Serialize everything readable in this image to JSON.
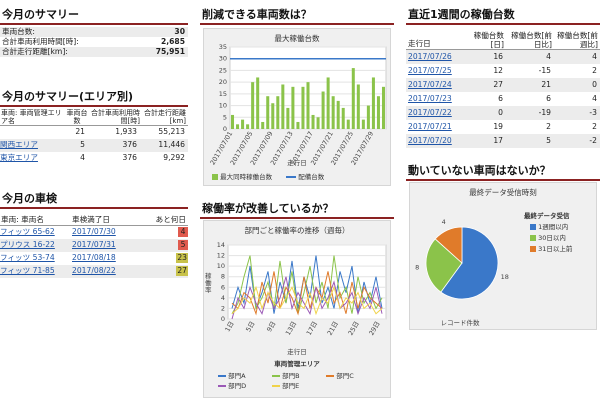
{
  "today_summary": {
    "title": "今月のサマリー",
    "rows": [
      {
        "label": "車両台数:",
        "value": "30"
      },
      {
        "label": "合計車両利用時間[時]:",
        "value": "2,685"
      },
      {
        "label": "合計走行距離[km]:",
        "value": "75,951"
      }
    ]
  },
  "area_summary": {
    "title": "今月のサマリー(エリア別)",
    "headers": [
      "車両: 車両管理エリア名",
      "車両台数",
      "合計車両利用時間[時]",
      "合計走行距離[km]"
    ],
    "rows": [
      {
        "name": "",
        "count": "21",
        "hours": "1,933",
        "km": "55,213"
      },
      {
        "name": "関西エリア",
        "count": "5",
        "hours": "376",
        "km": "11,446"
      },
      {
        "name": "東京エリア",
        "count": "4",
        "hours": "376",
        "km": "9,292"
      }
    ]
  },
  "inspection": {
    "title": "今月の車検",
    "headers": [
      "車両: 車両名",
      "車検満了日",
      "あと何日"
    ],
    "rows": [
      {
        "name": "フィッツ 65-62",
        "date": "2017/07/30",
        "days": "4",
        "color": "#e05a4e"
      },
      {
        "name": "プリウス 16-22",
        "date": "2017/07/31",
        "days": "5",
        "color": "#e05a4e"
      },
      {
        "name": "フィッツ 53-74",
        "date": "2017/08/18",
        "days": "23",
        "color": "#c8c24a"
      },
      {
        "name": "フィッツ 71-85",
        "date": "2017/08/22",
        "days": "27",
        "color": "#c8c24a"
      }
    ]
  },
  "reduce": {
    "title": "削減できる車両数は？",
    "chart_title": "最大稼働台数",
    "xlabel": "走行日",
    "legend": [
      "最大同時稼働台数",
      "配備台数"
    ],
    "chart_data": {
      "type": "bar",
      "ylim": [
        0,
        35
      ],
      "yticks": [
        "0",
        "5",
        "10",
        "15",
        "20",
        "25",
        "30",
        "35"
      ],
      "xticks": [
        "2017/07/01",
        "2017/07/05",
        "2017/07/09",
        "2017/07/13",
        "2017/07/17",
        "2017/07/21",
        "2017/07/25",
        "2017/07/29"
      ],
      "values": [
        6,
        2,
        4,
        2,
        20,
        22,
        3,
        14,
        11,
        14,
        19,
        9,
        18,
        3,
        18,
        20,
        6,
        5,
        16,
        22,
        14,
        12,
        9,
        4,
        26,
        19,
        4,
        10,
        22,
        14,
        18
      ],
      "deployed": 30
    }
  },
  "activity": {
    "title": "稼働率が改善しているか？",
    "chart_title": "部門ごと稼働率の推移（週毎）",
    "ylabel": "稼働率",
    "xlabel": "走行日",
    "legend_title": "車両管理エリア",
    "chart_data": {
      "type": "line",
      "ylim": [
        0,
        14
      ],
      "yticks": [
        "0",
        "2",
        "4",
        "6",
        "8",
        "10",
        "12",
        "14"
      ],
      "xticks": [
        "1日",
        "5日",
        "9日",
        "13日",
        "17日",
        "21日",
        "25日",
        "29日"
      ],
      "series": [
        {
          "name": "部門A",
          "color": "#3a78c9",
          "values": [
            2,
            6,
            3,
            10,
            2,
            5,
            9,
            1,
            7,
            3,
            11,
            2,
            8,
            4,
            12,
            3,
            6,
            2,
            9,
            5,
            10,
            1,
            7,
            3,
            8,
            2
          ]
        },
        {
          "name": "部門B",
          "color": "#8bc34a",
          "values": [
            1,
            3,
            8,
            12,
            2,
            4,
            7,
            2,
            11,
            3,
            9,
            1,
            5,
            10,
            3,
            7,
            2,
            12,
            4,
            6,
            1,
            8,
            3,
            5,
            2,
            4
          ]
        },
        {
          "name": "部門C",
          "color": "#e07b2a",
          "values": [
            3,
            2,
            5,
            4,
            1,
            7,
            3,
            9,
            2,
            6,
            4,
            1,
            8,
            2,
            6,
            4,
            9,
            3,
            5,
            1,
            7,
            2,
            6,
            4,
            3,
            2
          ]
        },
        {
          "name": "部門D",
          "color": "#9b59b6",
          "values": [
            0,
            4,
            2,
            6,
            3,
            1,
            5,
            2,
            4,
            8,
            2,
            5,
            3,
            1,
            6,
            2,
            4,
            7,
            2,
            3,
            5,
            1,
            4,
            2,
            6,
            1
          ]
        },
        {
          "name": "部門E",
          "color": "#f0d34a",
          "values": [
            1,
            2,
            4,
            3,
            6,
            2,
            5,
            3,
            2,
            4,
            6,
            3,
            2,
            5,
            1,
            4,
            3,
            6,
            2,
            4,
            3,
            5,
            2,
            3,
            1,
            2
          ]
        }
      ]
    }
  },
  "weekly": {
    "title": "直近1週間の稼働台数",
    "headers": [
      "走行日",
      "稼働台数[日]",
      "稼働台数[前日比]",
      "稼働台数[前週比]"
    ],
    "rows": [
      {
        "date": "2017/07/26",
        "a": "16",
        "b": "4",
        "c": "4"
      },
      {
        "date": "2017/07/25",
        "a": "12",
        "b": "-15",
        "c": "2"
      },
      {
        "date": "2017/07/24",
        "a": "27",
        "b": "21",
        "c": "0"
      },
      {
        "date": "2017/07/23",
        "a": "6",
        "b": "6",
        "c": "4"
      },
      {
        "date": "2017/07/22",
        "a": "0",
        "b": "-19",
        "c": "-3"
      },
      {
        "date": "2017/07/21",
        "a": "19",
        "b": "2",
        "c": "2"
      },
      {
        "date": "2017/07/20",
        "a": "17",
        "b": "5",
        "c": "-2"
      }
    ]
  },
  "idle": {
    "title": "動いていない車両はないか？",
    "chart_title": "最終データ受信時刻",
    "legend_title": "最終データ受信",
    "footer": "レコード件数",
    "chart_data": {
      "type": "pie",
      "slices": [
        {
          "label": "1週間以内",
          "value": 18,
          "color": "#3a78c9"
        },
        {
          "label": "30日以内",
          "value": 8,
          "color": "#8bc34a"
        },
        {
          "label": "31日以上前",
          "value": 4,
          "color": "#e07b2a"
        }
      ]
    }
  }
}
